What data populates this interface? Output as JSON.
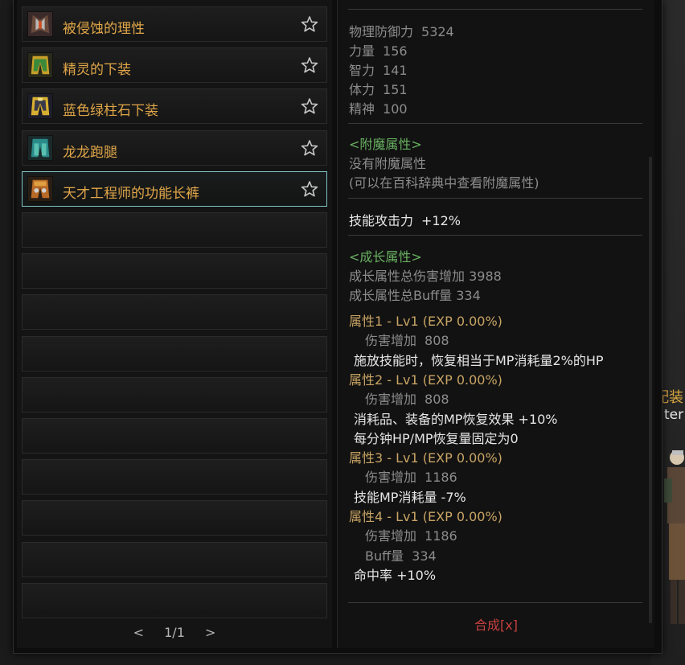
{
  "background": {
    "label_1": "配装",
    "label_2": "ter"
  },
  "items": [
    {
      "name": "被侵蚀的理性",
      "icon": "dark-armor-icon",
      "selected": false
    },
    {
      "name": "精灵的下装",
      "icon": "elf-pants-icon",
      "selected": false
    },
    {
      "name": "蓝色绿柱石下装",
      "icon": "beryl-pants-icon",
      "selected": false
    },
    {
      "name": "龙龙跑腿",
      "icon": "dragon-legs-icon",
      "selected": false
    },
    {
      "name": "天才工程师的功能长裤",
      "icon": "engineer-pants-icon",
      "selected": true
    }
  ],
  "empty_slot_count": 10,
  "pager": {
    "prev": "<",
    "page": "1/1",
    "next": ">"
  },
  "detail": {
    "base_stats": [
      {
        "label": "物理防御力",
        "value": "5324"
      },
      {
        "label": "力量",
        "value": "156"
      },
      {
        "label": "智力",
        "value": "141"
      },
      {
        "label": "体力",
        "value": "151"
      },
      {
        "label": "精神",
        "value": "100"
      }
    ],
    "enchant_header": "<附魔属性>",
    "enchant_none": "没有附魔属性",
    "enchant_hint": "(可以在百科辞典中查看附魔属性)",
    "skill_attack_label": "技能攻击力",
    "skill_attack_value": "+12%",
    "growth_header": "<成长属性>",
    "growth_total_damage": "成长属性总伤害增加 3988",
    "growth_total_buff": "成长属性总Buff量 334",
    "attributes": [
      {
        "title": "属性1 - Lv1 (EXP 0.00%)",
        "sub_label": "伤害增加",
        "sub_value": "808",
        "effects": [
          "施放技能时，恢复相当于MP消耗量2%的HP"
        ]
      },
      {
        "title": "属性2 - Lv1 (EXP 0.00%)",
        "sub_label": "伤害增加",
        "sub_value": "808",
        "effects": [
          "消耗品、装备的MP恢复效果 +10%",
          "每分钟HP/MP恢复量固定为0"
        ]
      },
      {
        "title": "属性3 - Lv1 (EXP 0.00%)",
        "sub_label": "伤害增加",
        "sub_value": "1186",
        "effects": [
          "技能MP消耗量 -7%"
        ]
      },
      {
        "title": "属性4 - Lv1 (EXP 0.00%)",
        "sub_label": "伤害增加",
        "sub_value": "1186",
        "extra_label": "Buff量",
        "extra_value": "334",
        "effects": [
          "命中率 +10%"
        ]
      }
    ],
    "synthesize_label": "合成[x]"
  },
  "colors": {
    "item_name": "#e0a648",
    "selected_border": "#7fc6c6",
    "section_header": "#68b060",
    "attribute_title": "#c8a464",
    "synthesize": "#c64040"
  }
}
